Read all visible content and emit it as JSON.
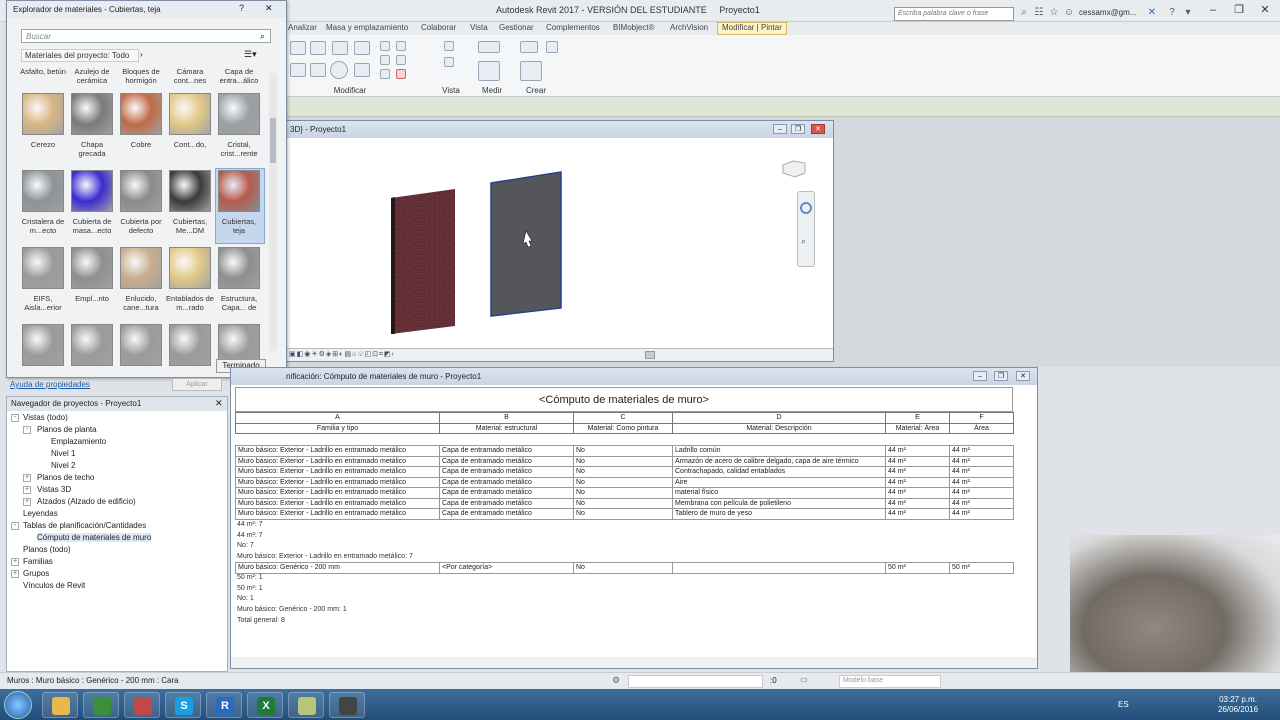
{
  "app": {
    "title": "Autodesk Revit 2017 - VERSIÓN DEL ESTUDIANTE",
    "project": "Proyecto1",
    "search_placeholder": "Escriba palabra clave o frase",
    "user": "cessamx@gm..."
  },
  "ribbon": {
    "tabs": [
      "Analizar",
      "Masa y emplazamiento",
      "Colaborar",
      "Vista",
      "Gestionar",
      "Complementos",
      "BIMobject®",
      "ArchVision",
      "Modificar | Pintar"
    ],
    "panels": [
      "Modificar",
      "Vista",
      "Medir",
      "Crear"
    ]
  },
  "material_browser": {
    "title": "Explorador de materiales - Cubiertas, teja",
    "search_placeholder": "Buscar",
    "filter": "Materiales del proyecto: Todo",
    "top_labels": [
      "Asfalto, betún",
      "Azulejo de cerámica",
      "Bloques de hormigón",
      "Cámara cont...nes",
      "Capa de entra...álico"
    ],
    "rows": [
      [
        {
          "label": "Cerezo",
          "swatch": "#d9b682"
        },
        {
          "label": "Chapa grecada",
          "swatch": "#7a7a7a"
        },
        {
          "label": "Cobre",
          "swatch": "#c06a45"
        },
        {
          "label": "Cont...do,",
          "swatch": "#e3c987"
        },
        {
          "label": "Cristal, crist...rente",
          "swatch": "#9aa0a3"
        }
      ],
      [
        {
          "label": "Cristalera de m...ecto",
          "swatch": "#8c9296"
        },
        {
          "label": "Cubierta de masa...ecto",
          "swatch": "#3b2bd0"
        },
        {
          "label": "Cubierta por defecto",
          "swatch": "#8a8a8a"
        },
        {
          "label": "Cubiertas, Me...DM",
          "swatch": "#3a3a3a"
        },
        {
          "label": "Cubiertas, teja",
          "swatch": "#b65a4a"
        }
      ],
      [
        {
          "label": "EIFS, Aisla...erior",
          "swatch": "#9a9a9a"
        },
        {
          "label": "Empl...nto",
          "swatch": "#8e8e8e"
        },
        {
          "label": "Enlucido, cane...tura",
          "swatch": "#c9ae8c"
        },
        {
          "label": "Entablados de m...rado",
          "swatch": "#e3c987"
        },
        {
          "label": "Estructura, Capa... de",
          "swatch": "#8e8e8e"
        }
      ],
      [
        {
          "label": "",
          "swatch": "#9a9a9a"
        },
        {
          "label": "",
          "swatch": "#9a9a9a"
        },
        {
          "label": "",
          "swatch": "#9a9a9a"
        },
        {
          "label": "",
          "swatch": "#9a9a9a"
        },
        {
          "label": "",
          "swatch": "#9a9a9a"
        }
      ]
    ],
    "done": "Terminado"
  },
  "properties": {
    "link": "Ayuda de propiedades",
    "apply": "Aplicar"
  },
  "project_browser": {
    "title": "Navegador de proyectos - Proyecto1",
    "nodes": [
      {
        "label": "Vistas (todo)",
        "level": 0,
        "toggle": "-"
      },
      {
        "label": "Planos de planta",
        "level": 1,
        "toggle": "-"
      },
      {
        "label": "Emplazamiento",
        "level": 2,
        "toggle": ""
      },
      {
        "label": "Nivel 1",
        "level": 2,
        "toggle": ""
      },
      {
        "label": "Nivel 2",
        "level": 2,
        "toggle": ""
      },
      {
        "label": "Planos de techo",
        "level": 1,
        "toggle": "+"
      },
      {
        "label": "Vistas 3D",
        "level": 1,
        "toggle": "+"
      },
      {
        "label": "Alzados (Alzado de edificio)",
        "level": 1,
        "toggle": "+"
      },
      {
        "label": "Leyendas",
        "level": 0,
        "toggle": ""
      },
      {
        "label": "Tablas de planificación/Cantidades",
        "level": 0,
        "toggle": "-"
      },
      {
        "label": "Cómputo de materiales de muro",
        "level": 1,
        "toggle": "",
        "selected": true
      },
      {
        "label": "Planos (todo)",
        "level": 0,
        "toggle": ""
      },
      {
        "label": "Familias",
        "level": 0,
        "toggle": "+"
      },
      {
        "label": "Grupos",
        "level": 0,
        "toggle": "+"
      },
      {
        "label": "Vínculos de Revit",
        "level": 0,
        "toggle": ""
      }
    ]
  },
  "view3d": {
    "title": "3D} - Proyecto1"
  },
  "schedule": {
    "window_title": "nificación: Cómputo de materiales de muro - Proyecto1",
    "title": "<Cómputo de materiales de muro>",
    "letters": [
      "A",
      "B",
      "C",
      "D",
      "E",
      "F"
    ],
    "headers": [
      "Familia y tipo",
      "Material: estructural",
      "Material: Como pintura",
      "Material: Descripción",
      "Material: Área",
      "Área"
    ],
    "group1_rows": [
      [
        "Muro básico: Exterior - Ladrillo en entramado metálico",
        "Capa de entramado metálico",
        "No",
        "Ladrillo común",
        "44 m²",
        "44 m²"
      ],
      [
        "Muro básico: Exterior - Ladrillo en entramado metálico",
        "Capa de entramado metálico",
        "No",
        "Armazón de acero de calibre delgado, capa de aire térmico",
        "44 m²",
        "44 m²"
      ],
      [
        "Muro básico: Exterior - Ladrillo en entramado metálico",
        "Capa de entramado metálico",
        "No",
        "Contrachapado, calidad entablados",
        "44 m²",
        "44 m²"
      ],
      [
        "Muro básico: Exterior - Ladrillo en entramado metálico",
        "Capa de entramado metálico",
        "No",
        "Aire",
        "44 m²",
        "44 m²"
      ],
      [
        "Muro básico: Exterior - Ladrillo en entramado metálico",
        "Capa de entramado metálico",
        "No",
        "material físico",
        "44 m²",
        "44 m²"
      ],
      [
        "Muro básico: Exterior - Ladrillo en entramado metálico",
        "Capa de entramado metálico",
        "No",
        "Membrana con película de polietileno",
        "44 m²",
        "44 m²"
      ],
      [
        "Muro básico: Exterior - Ladrillo en entramado metálico",
        "Capa de entramado metálico",
        "No",
        "Tablero de muro de yeso",
        "44 m²",
        "44 m²"
      ]
    ],
    "group1_totals": [
      "44 m²: 7",
      "44 m²: 7",
      "No: 7",
      "Muro básico: Exterior - Ladrillo en entramado metálico: 7"
    ],
    "group2_rows": [
      [
        "Muro básico: Genérico - 200 mm",
        "<Por categoría>",
        "No",
        "",
        "50 m²",
        "50 m²"
      ]
    ],
    "group2_totals": [
      "50 m²: 1",
      "50 m²: 1",
      "No: 1",
      "Muro básico: Genérico - 200 mm: 1",
      "Total general: 8"
    ]
  },
  "status": {
    "text": "Muros : Muro básico : Genérico - 200 mm : Cara",
    "zoom": ":0",
    "model_base": "Modelo base"
  },
  "taskbar": {
    "lang": "ES",
    "time": "03:27 p.m.",
    "date": "26/06/2016",
    "apps": [
      {
        "letter": "",
        "color": "#e7b84a"
      },
      {
        "letter": "",
        "color": "#3b8f3b"
      },
      {
        "letter": "",
        "color": "#c04848"
      },
      {
        "letter": "S",
        "color": "#1aa0e0"
      },
      {
        "letter": "R",
        "color": "#2a6bc0"
      },
      {
        "letter": "X",
        "color": "#1f7a3c"
      },
      {
        "letter": "",
        "color": "#b9c57a"
      },
      {
        "letter": "",
        "color": "#444"
      }
    ]
  }
}
